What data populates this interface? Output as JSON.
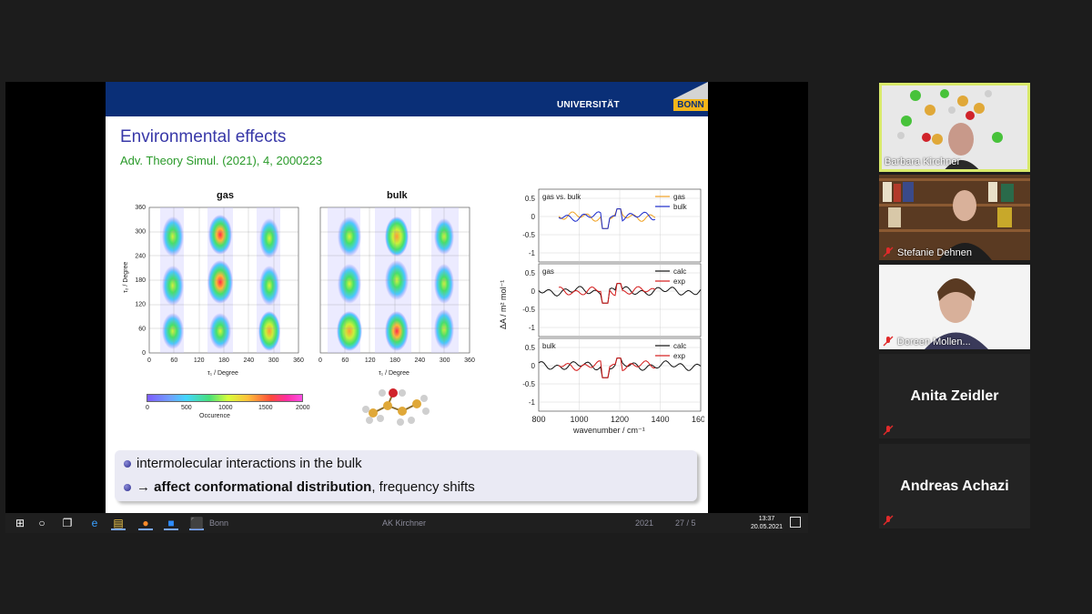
{
  "slide": {
    "logo_text": "UNIVERSITÄT",
    "logo_bonn": "BONN",
    "title": "Environmental effects",
    "subtitle": "Adv. Theory Simul. (2021), 4, 2000223",
    "heatmaps": {
      "gas_title": "gas",
      "bulk_title": "bulk",
      "ylabel": "τ₂ / Degree",
      "xlabel": "τ₁ / Degree",
      "ticks": [
        "0",
        "60",
        "120",
        "180",
        "240",
        "300",
        "360"
      ]
    },
    "colorbar": {
      "ticks": [
        "0",
        "500",
        "1000",
        "1500",
        "2000"
      ],
      "label": "Occurence"
    },
    "spectra": {
      "panels": [
        {
          "label": "gas vs. bulk",
          "legend": [
            "gas",
            "bulk"
          ]
        },
        {
          "label": "gas",
          "legend": [
            "calc",
            "exp"
          ]
        },
        {
          "label": "bulk",
          "legend": [
            "calc",
            "exp"
          ]
        }
      ],
      "yticks": [
        "0.5",
        "0",
        "-0.5",
        "-1"
      ],
      "xticks": [
        "800",
        "1000",
        "1200",
        "1400",
        "1600"
      ],
      "xlabel": "wavenumber / cm⁻¹",
      "ylabel": "ΔA / m² mol⁻¹"
    },
    "bullets": [
      {
        "text": "intermolecular interactions in the bulk"
      },
      {
        "bold": "→ affect conformational distribution",
        "rest": ", frequency shifts"
      }
    ],
    "footer": {
      "left": "Bonn",
      "center": "AK Kirchner",
      "year": "2021",
      "page": "27 / 5"
    }
  },
  "taskbar": {
    "time": "13:37",
    "date": "20.05.2021"
  },
  "participants": [
    {
      "name": "Barbara Kirchner",
      "muted": false
    },
    {
      "name": "Stefanie Dehnen",
      "muted": true
    },
    {
      "name": "Doreen Mollen...",
      "muted": true
    },
    {
      "name": "Anita Zeidler",
      "muted": true
    },
    {
      "name": "Andreas Achazi",
      "muted": true
    }
  ],
  "colors": {
    "slide_header": "#0a2f77",
    "title": "#3838a8",
    "subtitle": "#2a9a2a",
    "active_speaker_border": "#d8e96a"
  }
}
